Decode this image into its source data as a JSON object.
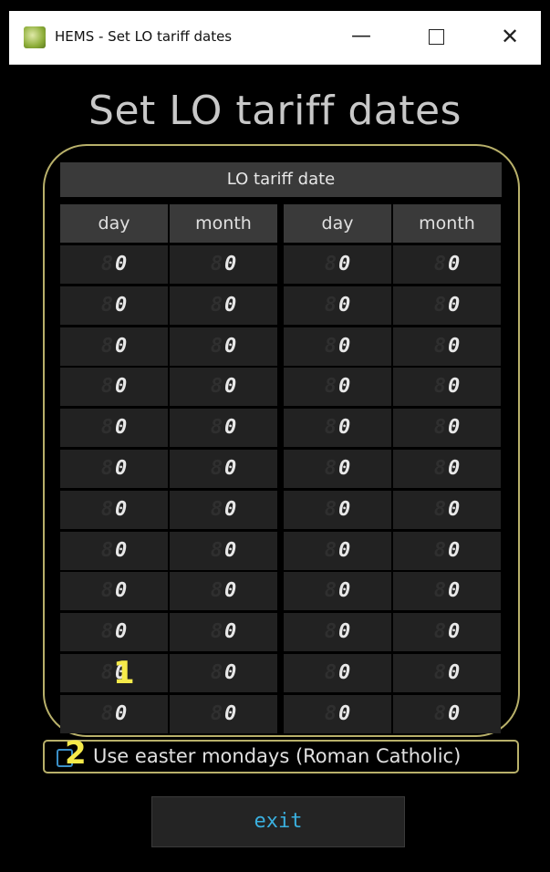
{
  "window": {
    "title": "HEMS - Set LO tariff dates",
    "minimize_glyph": "—",
    "close_glyph": "✕"
  },
  "page": {
    "title": "Set LO tariff dates"
  },
  "table": {
    "header": "LO tariff date",
    "columns": [
      "day",
      "month",
      "day",
      "month"
    ],
    "rows": [
      [
        "0",
        "0",
        "0",
        "0"
      ],
      [
        "0",
        "0",
        "0",
        "0"
      ],
      [
        "0",
        "0",
        "0",
        "0"
      ],
      [
        "0",
        "0",
        "0",
        "0"
      ],
      [
        "0",
        "0",
        "0",
        "0"
      ],
      [
        "0",
        "0",
        "0",
        "0"
      ],
      [
        "0",
        "0",
        "0",
        "0"
      ],
      [
        "0",
        "0",
        "0",
        "0"
      ],
      [
        "0",
        "0",
        "0",
        "0"
      ],
      [
        "0",
        "0",
        "0",
        "0"
      ],
      [
        "0",
        "0",
        "0",
        "0"
      ],
      [
        "0",
        "0",
        "0",
        "0"
      ]
    ],
    "ghost_digit": "8"
  },
  "easter": {
    "label": "Use easter mondays (Roman Catholic)",
    "checked": false
  },
  "exit_label": "exit",
  "markers": [
    "1",
    "2"
  ],
  "colors": {
    "frame": "#b8b06a",
    "marker": "#f5ea4a",
    "exit_text": "#3ab0df"
  }
}
